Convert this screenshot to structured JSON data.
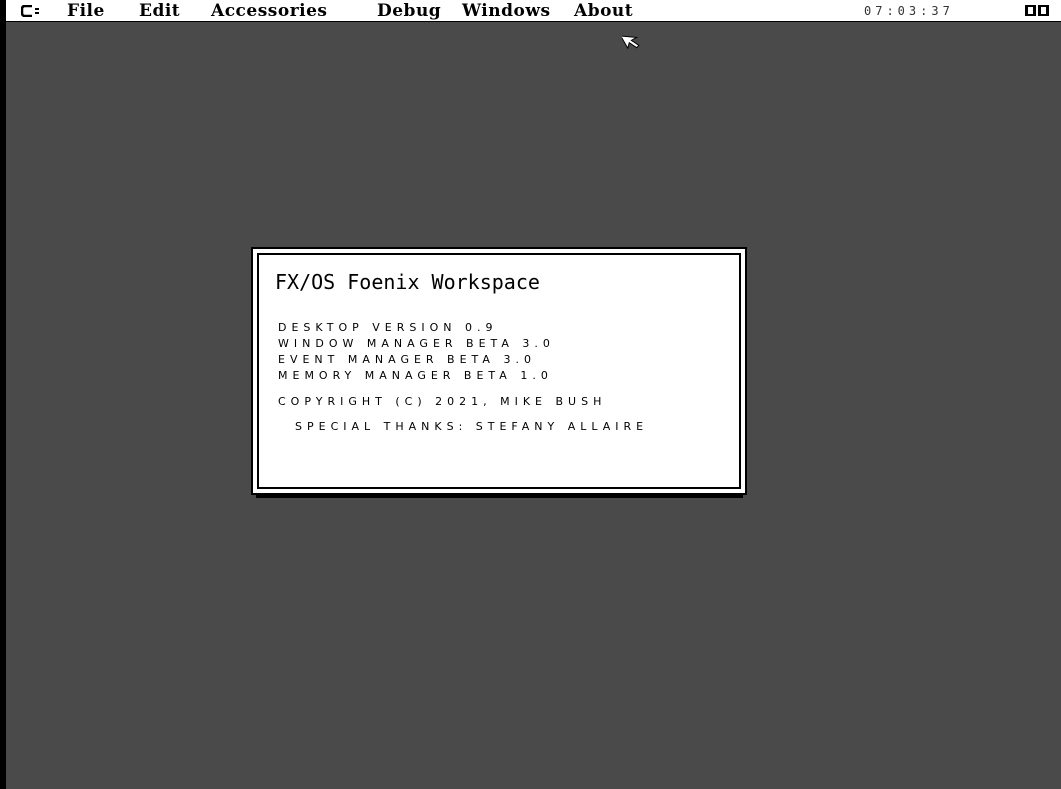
{
  "menubar": {
    "items": [
      "File",
      "Edit",
      "Accessories",
      "Debug",
      "Windows",
      "About"
    ],
    "clock": "07:03:37"
  },
  "about_dialog": {
    "title": "FX/OS Foenix Workspace",
    "lines": [
      "Desktop Version 0.9",
      "Window Manager Beta 3.0",
      "Event Manager Beta 3.0",
      "Memory Manager Beta 1.0"
    ],
    "copyright": "Copyright (c) 2021, Mike Bush",
    "thanks": "Special Thanks: Stefany Allaire"
  },
  "colors": {
    "desktop": "#4a4a4a",
    "menubar": "#ffffff",
    "dialog": "#ffffff",
    "frame": "#000000"
  }
}
